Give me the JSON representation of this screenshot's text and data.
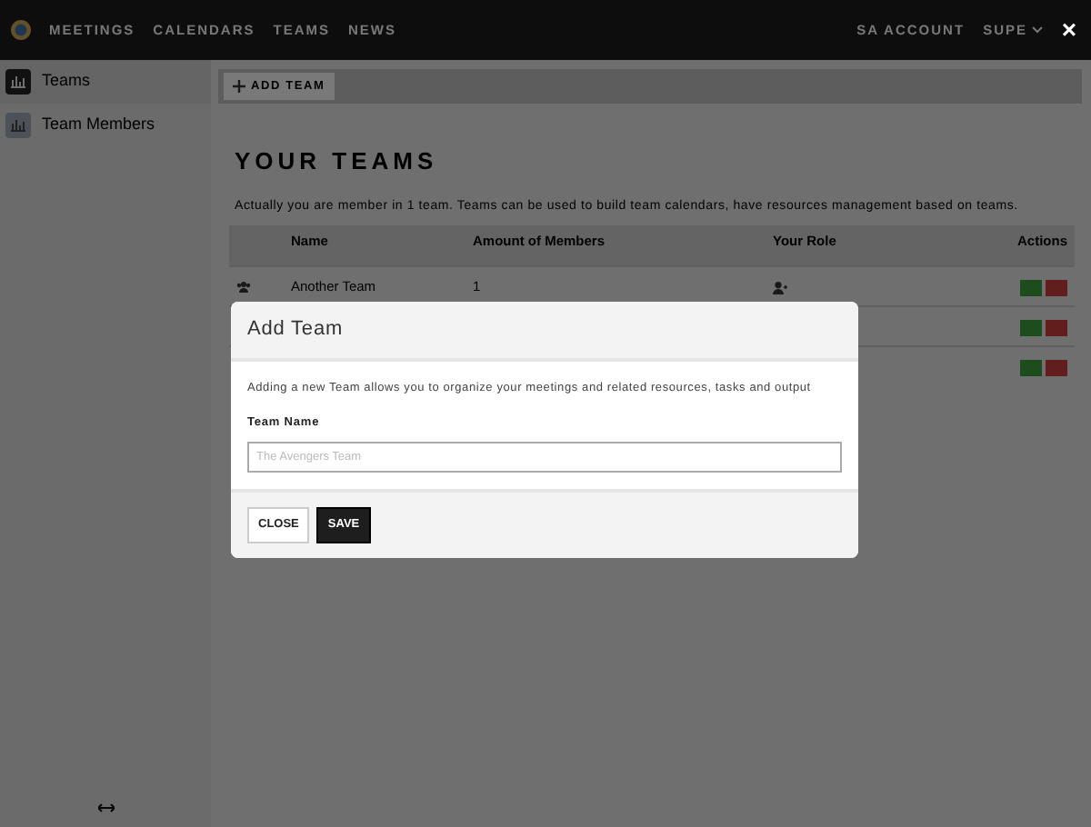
{
  "navbar": {
    "items": [
      {
        "label": "MEETINGS"
      },
      {
        "label": "CALENDARS"
      },
      {
        "label": "TEAMS"
      },
      {
        "label": "NEWS"
      }
    ],
    "right_items": [
      {
        "label": "SA ACCOUNT"
      },
      {
        "label": "SUPE"
      }
    ]
  },
  "sidebar": {
    "items": [
      {
        "label": "Teams",
        "selected": true
      },
      {
        "label": "Team Members",
        "selected": false
      }
    ]
  },
  "toolbar": {
    "add_button": "ADD TEAM"
  },
  "page": {
    "title": "YOUR TEAMS",
    "description": "Actually you are member in 1 team. Teams can be used to build team calendars, have resources management based on teams."
  },
  "table": {
    "columns": [
      "Name",
      "Amount of Members",
      "Your Role",
      "Actions"
    ],
    "rows": [
      {
        "name": "Another Team",
        "members": "1",
        "actions": [
          {
            "kind": "view"
          },
          {
            "kind": "delete"
          }
        ]
      },
      {
        "actions": [
          {
            "kind": "view"
          },
          {
            "kind": "delete"
          }
        ]
      },
      {
        "actions": [
          {
            "kind": "view"
          },
          {
            "kind": "delete"
          }
        ]
      }
    ]
  },
  "overlay_close": "×",
  "modal": {
    "title": "Add Team",
    "description": "Adding a new Team allows you to organize your meetings and related resources, tasks and output",
    "field_label": "Team Name",
    "placeholder": "The Avengers Team",
    "buttons": [
      {
        "label": "CLOSE",
        "kind": "secondary"
      },
      {
        "label": "SAVE",
        "kind": "primary"
      }
    ]
  }
}
